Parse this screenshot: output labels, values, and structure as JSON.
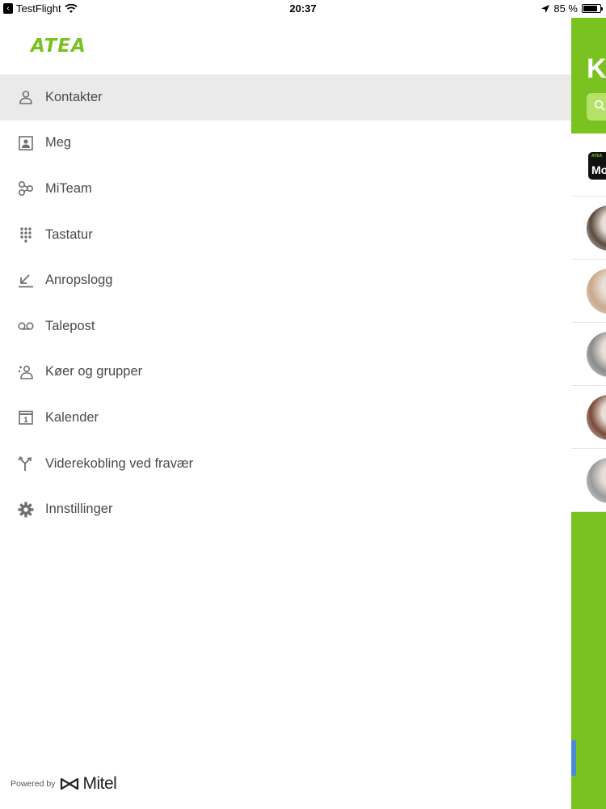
{
  "status_bar": {
    "app": "TestFlight",
    "time": "20:37",
    "battery": "85 %",
    "battery_level": 0.85
  },
  "brand": {
    "logo": "ATEA",
    "color": "#7ac21f"
  },
  "menu": {
    "active_index": 0,
    "items": [
      {
        "label": "Kontakter",
        "icon": "person-icon"
      },
      {
        "label": "Meg",
        "icon": "profile-card-icon"
      },
      {
        "label": "MiTeam",
        "icon": "team-icon"
      },
      {
        "label": "Tastatur",
        "icon": "keypad-icon"
      },
      {
        "label": "Anropslogg",
        "icon": "call-log-icon"
      },
      {
        "label": "Talepost",
        "icon": "voicemail-icon"
      },
      {
        "label": "Køer og grupper",
        "icon": "groups-icon"
      },
      {
        "label": "Kalender",
        "icon": "calendar-icon"
      },
      {
        "label": "Viderekobling ved fravær",
        "icon": "forward-icon"
      },
      {
        "label": "Innstillinger",
        "icon": "gear-icon"
      }
    ]
  },
  "footer": {
    "powered_by": "Powered by",
    "vendor": "Mitel"
  },
  "right_panel": {
    "title_partial": "K",
    "first_tile": {
      "small": "ATEA",
      "text": "Mo"
    },
    "avatar_colors": [
      "#5b4b3e",
      "#c9a98b",
      "#8a8a8a",
      "#7a4a3a",
      "#9a9a9a"
    ]
  }
}
